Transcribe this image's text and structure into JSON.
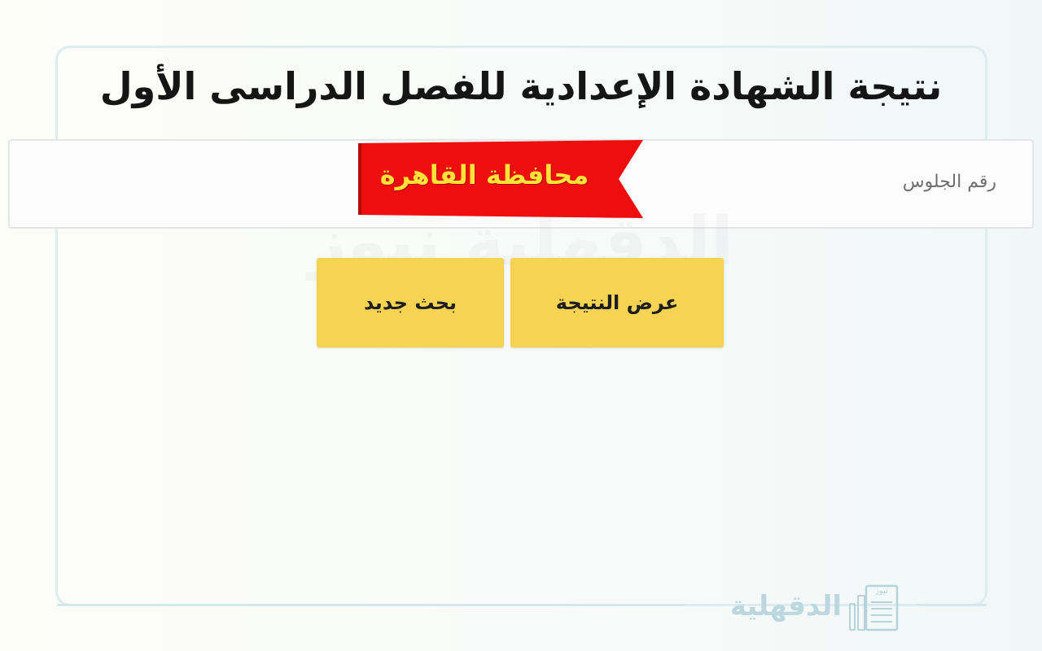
{
  "header": {
    "title": "نتيجة الشهادة الإعدادية للفصل الدراسى الأول"
  },
  "form": {
    "seat_number_label": "رقم الجلوس",
    "region_banner": "محافظة القاهرة"
  },
  "buttons": {
    "show_result": "عرض النتيجة",
    "new_search": "بحث جديد"
  },
  "watermark": {
    "text": "الدقهلية نيوز"
  },
  "brand": {
    "name": "الدقهلية",
    "sub": "نيوز",
    "icon": "newspaper-icon"
  },
  "colors": {
    "button": "#f6d352",
    "banner": "#ee0e0e",
    "banner_text": "#ffe23a",
    "card_border": "#dcecef"
  }
}
